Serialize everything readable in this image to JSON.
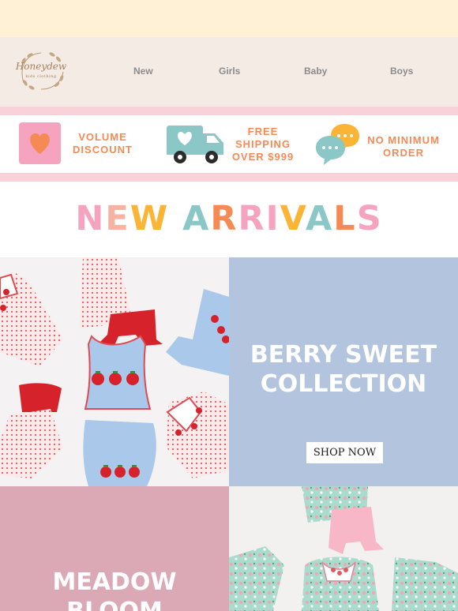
{
  "brand": {
    "name": "Honeydew",
    "tagline": "kids clothing"
  },
  "nav": {
    "items": [
      {
        "label": "New"
      },
      {
        "label": "Girls"
      },
      {
        "label": "Baby"
      },
      {
        "label": "Boys"
      }
    ]
  },
  "perks": [
    {
      "icon": "heart-icon",
      "line1": "VOLUME",
      "line2": "DISCOUNT"
    },
    {
      "icon": "truck-icon",
      "line1": "FREE",
      "line2": "SHIPPING",
      "line3": "OVER $999"
    },
    {
      "icon": "chat-bubbles-icon",
      "line1": "NO MINIMUM",
      "line2": "ORDER"
    }
  ],
  "arrivals": {
    "title": "NEW ARRIVALS"
  },
  "collections": [
    {
      "title_line1": "BERRY SWEET",
      "title_line2": "COLLECTION",
      "cta": "SHOP NOW"
    },
    {
      "title_line1": "MEADOW",
      "title_line2": "BLOOM"
    }
  ],
  "colors": {
    "topbar": "#fff1d6",
    "nav_bg": "#f5ebe5",
    "pink_strip": "#f9d1d8",
    "accent_orange": "#f58a55",
    "berry_panel": "#b2c4de",
    "meadow_panel": "#dba9b6"
  }
}
